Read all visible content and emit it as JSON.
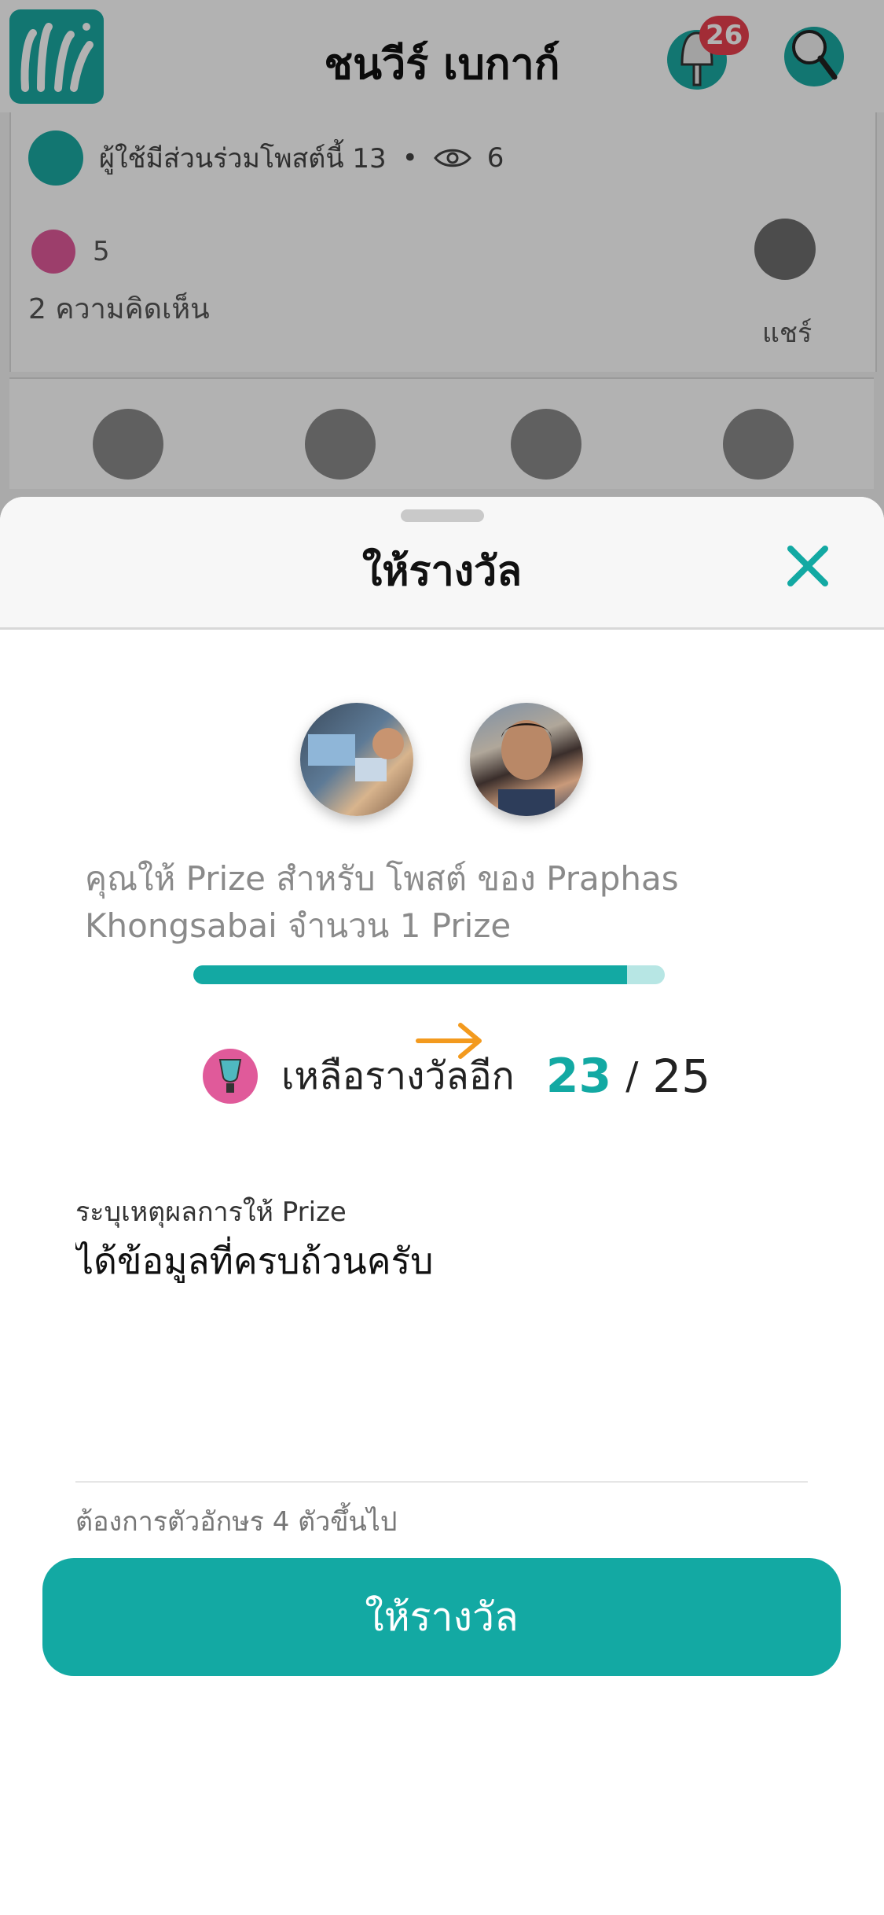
{
  "header": {
    "title": "ชนวีร์ เบกาก์",
    "notification_count": "26"
  },
  "post": {
    "participants_text": "ผู้ใช้มีส่วนร่วมโพสต์นี้ 13",
    "separator": "•",
    "views": "6",
    "likes": "5",
    "comments": "2 ความคิดเห็น",
    "share_label": "แชร์"
  },
  "sheet": {
    "title": "ให้รางวัล",
    "description": "คุณให้ Prize สำหรับ โพสต์ ของ Praphas Khongsabai จำนวน 1 Prize",
    "progress_fraction": 0.92,
    "remaining_label": "เหลือรางวัลอีก",
    "remaining": "23",
    "slash": "/",
    "total": "25",
    "reason_label": "ระบุเหตุผลการให้ Prize",
    "reason_value": "ได้ข้อมูลที่ครบถ้วนครับ",
    "hint": "ต้องการตัวอักษร 4 ตัวขึ้นไป",
    "submit_label": "ให้รางวัล"
  },
  "colors": {
    "accent": "#13a9a3",
    "accent_light": "#b7e6e4",
    "arrow": "#f39a1e",
    "badge": "#e8404e"
  }
}
